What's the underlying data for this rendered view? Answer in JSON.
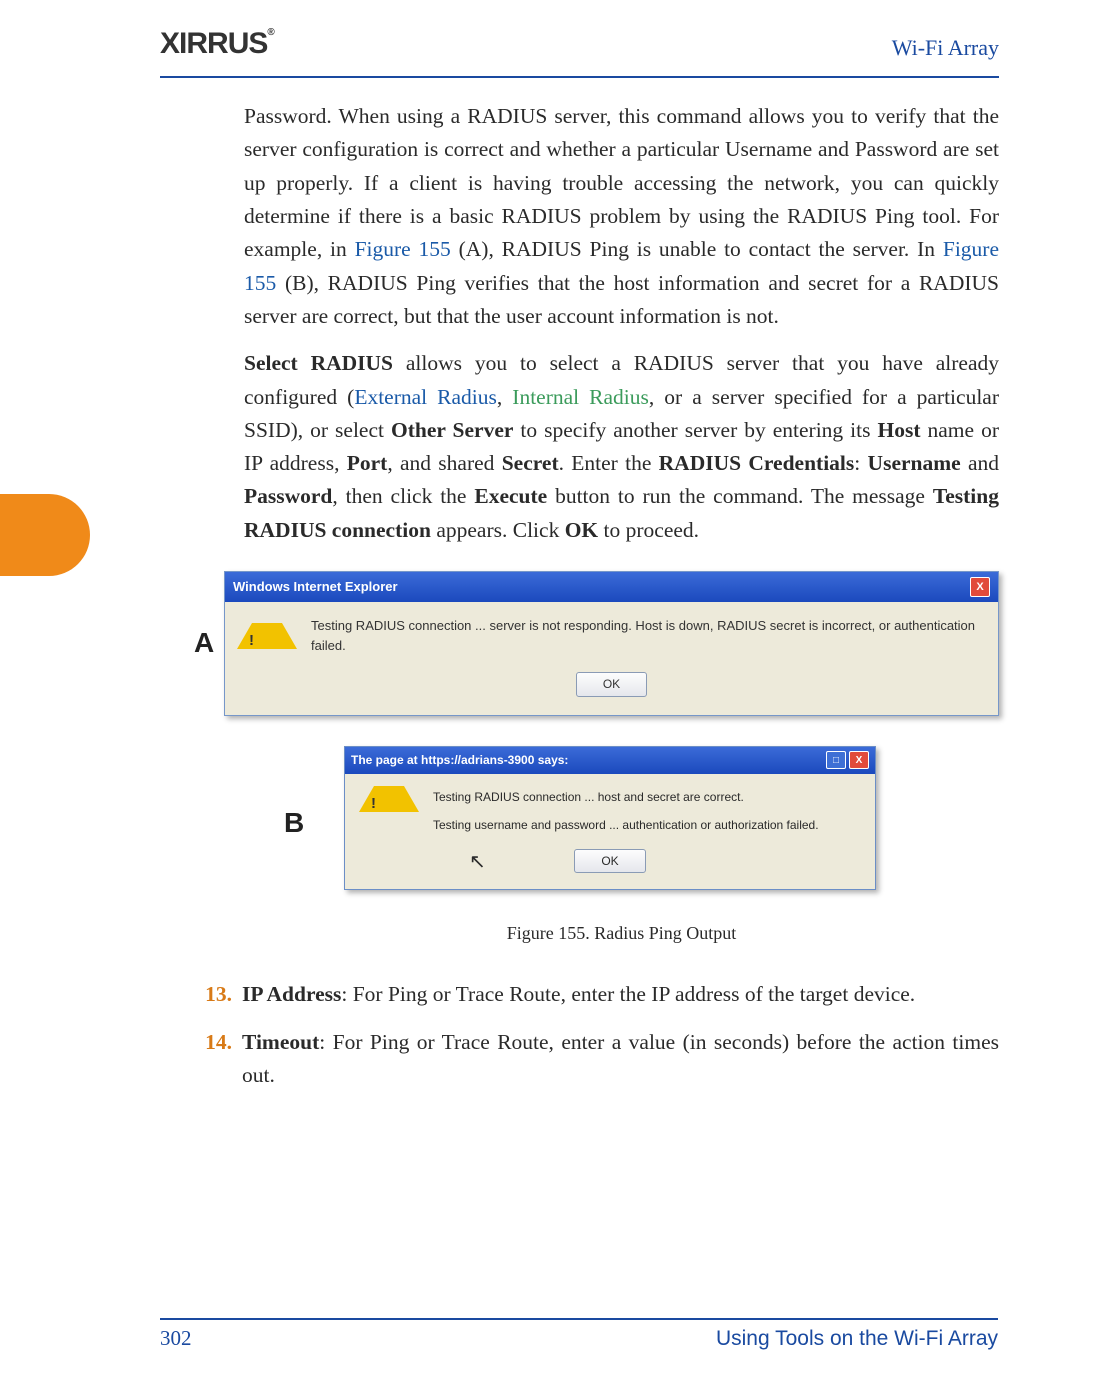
{
  "header": {
    "logo_text": "XIRRUS",
    "right_text": "Wi-Fi Array"
  },
  "footer": {
    "page_number": "302",
    "section_title": "Using Tools on the Wi-Fi Array"
  },
  "paragraphs": {
    "p1_a": "Password. When using a RADIUS server, this command allows you to verify that the server configuration is correct and whether a particular Username and Password are set up properly. If a client is having trouble accessing the network, you can quickly determine if there is a basic RADIUS problem by using the RADIUS Ping tool. For example, in ",
    "p1_link1": "Figure 155",
    "p1_b": " (A), RADIUS Ping is unable to contact the server. In ",
    "p1_link2": "Figure 155",
    "p1_c": " (B), RADIUS Ping verifies that the host information and secret for a RADIUS server are correct, but that the user account information is not.",
    "p2_a_bold": "Select RADIUS",
    "p2_a": " allows you to select a RADIUS server that you have already configured (",
    "p2_link1": "External Radius",
    "p2_sep": ", ",
    "p2_link2": "Internal Radius",
    "p2_b": ", or a server specified for a particular SSID), or select ",
    "p2_bold1": "Other Server",
    "p2_c": " to specify another server by entering its ",
    "p2_bold2": "Host",
    "p2_d": " name or IP address, ",
    "p2_bold3": "Port",
    "p2_e": ", and shared ",
    "p2_bold4": "Secret",
    "p2_f": ". Enter the ",
    "p2_bold5": "RADIUS Credentials",
    "p2_g": ": ",
    "p2_bold6": "Username",
    "p2_h": " and ",
    "p2_bold7": "Password",
    "p2_i": ", then click the ",
    "p2_bold8": "Execute",
    "p2_j": " button to run the command. The message ",
    "p2_bold9": "Testing RADIUS connection",
    "p2_k": " appears. Click ",
    "p2_bold10": "OK",
    "p2_l": " to proceed."
  },
  "dialog_a": {
    "label": "A",
    "title": "Windows Internet Explorer",
    "message": "Testing RADIUS connection ... server is not responding. Host is down, RADIUS secret is incorrect, or authentication failed.",
    "ok_label": "OK"
  },
  "dialog_b": {
    "label": "B",
    "title": "The page at https://adrians-3900 says:",
    "message1": "Testing RADIUS connection ... host and secret are correct.",
    "message2": "Testing username and password ... authentication or authorization failed.",
    "ok_label": "OK"
  },
  "caption": "Figure 155. Radius Ping Output",
  "steps": {
    "s13_num": "13.",
    "s13_bold": "IP Address",
    "s13_text": ": For Ping or Trace Route, enter the IP address of the target device.",
    "s14_num": "14.",
    "s14_bold": "Timeout",
    "s14_text": ": For Ping or Trace Route, enter a value (in seconds) before the action times out."
  }
}
